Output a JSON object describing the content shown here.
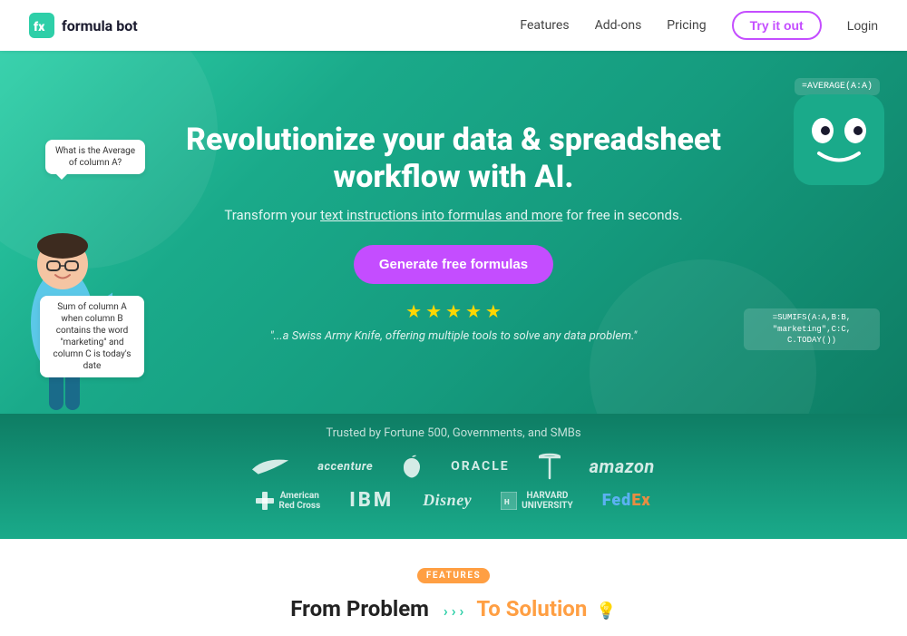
{
  "navbar": {
    "logo_text": "formula bot",
    "links": [
      "Features",
      "Add-ons",
      "Pricing"
    ],
    "try_label": "Try it out",
    "login_label": "Login"
  },
  "hero": {
    "title": "Revolutionize your data & spreadsheet workflow with AI.",
    "subtitle_pre": "Transform your ",
    "subtitle_underline": "text instructions into formulas and more",
    "subtitle_post": " for free in seconds.",
    "cta_label": "Generate free formulas",
    "quote": "\"...a Swiss Army Knife, offering multiple tools to solve any data problem.\"",
    "speech1": "What is the Average of column A?",
    "speech2": "Sum of column A when column B contains the word \"marketing\" and column C is today's date",
    "formula1": "=AVERAGE(A:A)",
    "formula2": "=SUMIFS(A:A,B:B,\n\"marketing\",C:C,\nC.TODAY())"
  },
  "trusted": {
    "label": "Trusted by Fortune 500, Governments, and SMBs",
    "logos_row1": [
      "Nike",
      "accenture",
      "Apple",
      "ORACLE",
      "Tesla",
      "amazon"
    ],
    "logos_row2": [
      "American Red Cross",
      "IBM",
      "Disney",
      "Harvard University",
      "FedEx"
    ]
  },
  "features": {
    "badge": "FEATURES",
    "title_pre": "From ",
    "problem": "Problem",
    "solution": "To Solution"
  },
  "stars": [
    "★",
    "★",
    "★",
    "★",
    "★"
  ]
}
